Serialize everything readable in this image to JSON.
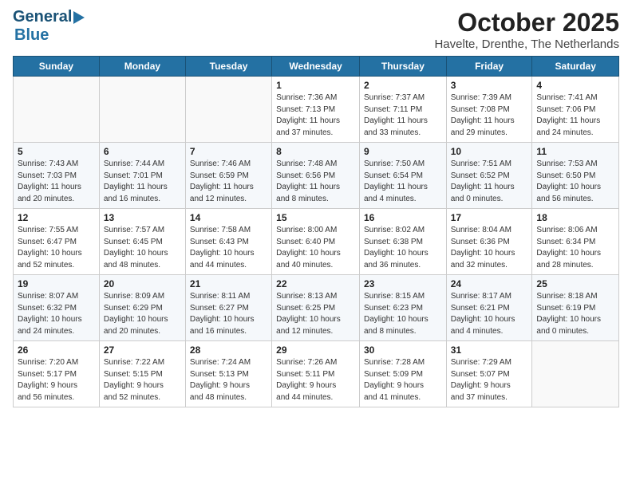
{
  "header": {
    "logo_general": "General",
    "logo_blue": "Blue",
    "title": "October 2025",
    "subtitle": "Havelte, Drenthe, The Netherlands"
  },
  "days_of_week": [
    "Sunday",
    "Monday",
    "Tuesday",
    "Wednesday",
    "Thursday",
    "Friday",
    "Saturday"
  ],
  "weeks": [
    [
      {
        "day": "",
        "info": ""
      },
      {
        "day": "",
        "info": ""
      },
      {
        "day": "",
        "info": ""
      },
      {
        "day": "1",
        "info": "Sunrise: 7:36 AM\nSunset: 7:13 PM\nDaylight: 11 hours\nand 37 minutes."
      },
      {
        "day": "2",
        "info": "Sunrise: 7:37 AM\nSunset: 7:11 PM\nDaylight: 11 hours\nand 33 minutes."
      },
      {
        "day": "3",
        "info": "Sunrise: 7:39 AM\nSunset: 7:08 PM\nDaylight: 11 hours\nand 29 minutes."
      },
      {
        "day": "4",
        "info": "Sunrise: 7:41 AM\nSunset: 7:06 PM\nDaylight: 11 hours\nand 24 minutes."
      }
    ],
    [
      {
        "day": "5",
        "info": "Sunrise: 7:43 AM\nSunset: 7:03 PM\nDaylight: 11 hours\nand 20 minutes."
      },
      {
        "day": "6",
        "info": "Sunrise: 7:44 AM\nSunset: 7:01 PM\nDaylight: 11 hours\nand 16 minutes."
      },
      {
        "day": "7",
        "info": "Sunrise: 7:46 AM\nSunset: 6:59 PM\nDaylight: 11 hours\nand 12 minutes."
      },
      {
        "day": "8",
        "info": "Sunrise: 7:48 AM\nSunset: 6:56 PM\nDaylight: 11 hours\nand 8 minutes."
      },
      {
        "day": "9",
        "info": "Sunrise: 7:50 AM\nSunset: 6:54 PM\nDaylight: 11 hours\nand 4 minutes."
      },
      {
        "day": "10",
        "info": "Sunrise: 7:51 AM\nSunset: 6:52 PM\nDaylight: 11 hours\nand 0 minutes."
      },
      {
        "day": "11",
        "info": "Sunrise: 7:53 AM\nSunset: 6:50 PM\nDaylight: 10 hours\nand 56 minutes."
      }
    ],
    [
      {
        "day": "12",
        "info": "Sunrise: 7:55 AM\nSunset: 6:47 PM\nDaylight: 10 hours\nand 52 minutes."
      },
      {
        "day": "13",
        "info": "Sunrise: 7:57 AM\nSunset: 6:45 PM\nDaylight: 10 hours\nand 48 minutes."
      },
      {
        "day": "14",
        "info": "Sunrise: 7:58 AM\nSunset: 6:43 PM\nDaylight: 10 hours\nand 44 minutes."
      },
      {
        "day": "15",
        "info": "Sunrise: 8:00 AM\nSunset: 6:40 PM\nDaylight: 10 hours\nand 40 minutes."
      },
      {
        "day": "16",
        "info": "Sunrise: 8:02 AM\nSunset: 6:38 PM\nDaylight: 10 hours\nand 36 minutes."
      },
      {
        "day": "17",
        "info": "Sunrise: 8:04 AM\nSunset: 6:36 PM\nDaylight: 10 hours\nand 32 minutes."
      },
      {
        "day": "18",
        "info": "Sunrise: 8:06 AM\nSunset: 6:34 PM\nDaylight: 10 hours\nand 28 minutes."
      }
    ],
    [
      {
        "day": "19",
        "info": "Sunrise: 8:07 AM\nSunset: 6:32 PM\nDaylight: 10 hours\nand 24 minutes."
      },
      {
        "day": "20",
        "info": "Sunrise: 8:09 AM\nSunset: 6:29 PM\nDaylight: 10 hours\nand 20 minutes."
      },
      {
        "day": "21",
        "info": "Sunrise: 8:11 AM\nSunset: 6:27 PM\nDaylight: 10 hours\nand 16 minutes."
      },
      {
        "day": "22",
        "info": "Sunrise: 8:13 AM\nSunset: 6:25 PM\nDaylight: 10 hours\nand 12 minutes."
      },
      {
        "day": "23",
        "info": "Sunrise: 8:15 AM\nSunset: 6:23 PM\nDaylight: 10 hours\nand 8 minutes."
      },
      {
        "day": "24",
        "info": "Sunrise: 8:17 AM\nSunset: 6:21 PM\nDaylight: 10 hours\nand 4 minutes."
      },
      {
        "day": "25",
        "info": "Sunrise: 8:18 AM\nSunset: 6:19 PM\nDaylight: 10 hours\nand 0 minutes."
      }
    ],
    [
      {
        "day": "26",
        "info": "Sunrise: 7:20 AM\nSunset: 5:17 PM\nDaylight: 9 hours\nand 56 minutes."
      },
      {
        "day": "27",
        "info": "Sunrise: 7:22 AM\nSunset: 5:15 PM\nDaylight: 9 hours\nand 52 minutes."
      },
      {
        "day": "28",
        "info": "Sunrise: 7:24 AM\nSunset: 5:13 PM\nDaylight: 9 hours\nand 48 minutes."
      },
      {
        "day": "29",
        "info": "Sunrise: 7:26 AM\nSunset: 5:11 PM\nDaylight: 9 hours\nand 44 minutes."
      },
      {
        "day": "30",
        "info": "Sunrise: 7:28 AM\nSunset: 5:09 PM\nDaylight: 9 hours\nand 41 minutes."
      },
      {
        "day": "31",
        "info": "Sunrise: 7:29 AM\nSunset: 5:07 PM\nDaylight: 9 hours\nand 37 minutes."
      },
      {
        "day": "",
        "info": ""
      }
    ]
  ]
}
